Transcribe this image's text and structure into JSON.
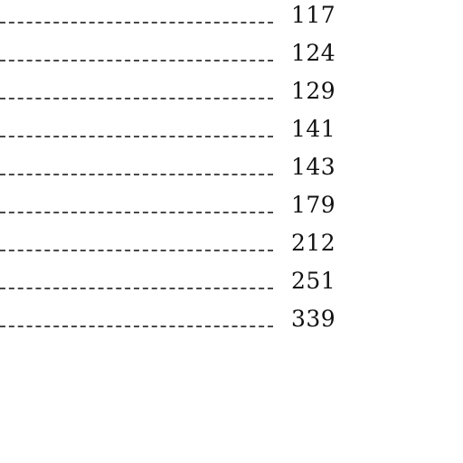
{
  "toc": {
    "entries": [
      {
        "page": "117"
      },
      {
        "page": "124"
      },
      {
        "page": "129"
      },
      {
        "page": "141"
      },
      {
        "page": "143"
      },
      {
        "page": "179"
      },
      {
        "page": "212"
      },
      {
        "page": "251"
      },
      {
        "page": "339"
      }
    ]
  }
}
